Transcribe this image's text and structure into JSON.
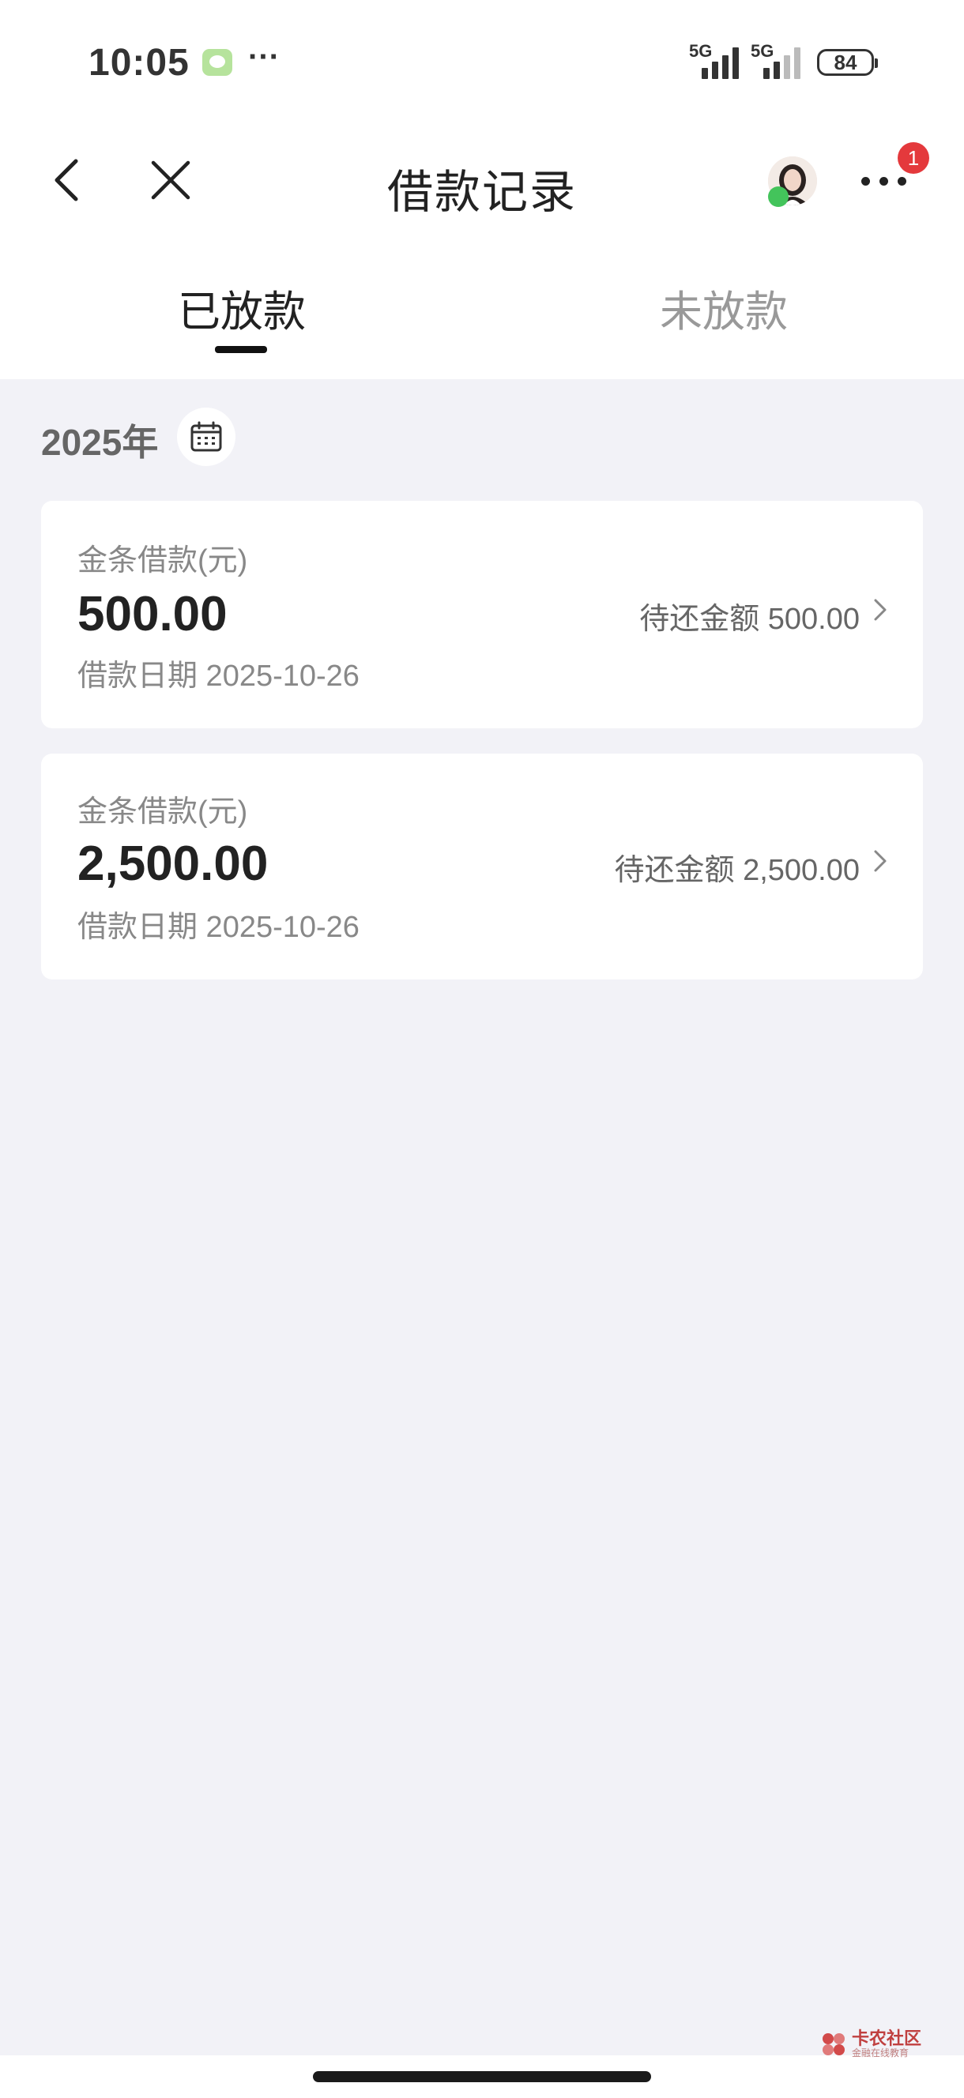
{
  "status_bar": {
    "time": "10:05",
    "more": "···",
    "signal1": "5G",
    "signal2": "5G",
    "battery": "84"
  },
  "nav": {
    "title": "借款记录",
    "notification_count": "1"
  },
  "tabs": [
    {
      "label": "已放款",
      "active": true
    },
    {
      "label": "未放款",
      "active": false
    }
  ],
  "year": "2025年",
  "loans": [
    {
      "label": "金条借款(元)",
      "amount": "500.00",
      "date": "借款日期 2025-10-26",
      "remaining": "待还金额 500.00"
    },
    {
      "label": "金条借款(元)",
      "amount": "2,500.00",
      "date": "借款日期 2025-10-26",
      "remaining": "待还金额 2,500.00"
    }
  ],
  "watermark": {
    "title": "卡农社区",
    "subtitle": "金融在线教育"
  },
  "colors": {
    "page_bg": "#f2f2f7",
    "card_bg": "#ffffff",
    "badge_red": "#e4393c",
    "text_dark": "#222222",
    "text_gray": "#888888"
  }
}
